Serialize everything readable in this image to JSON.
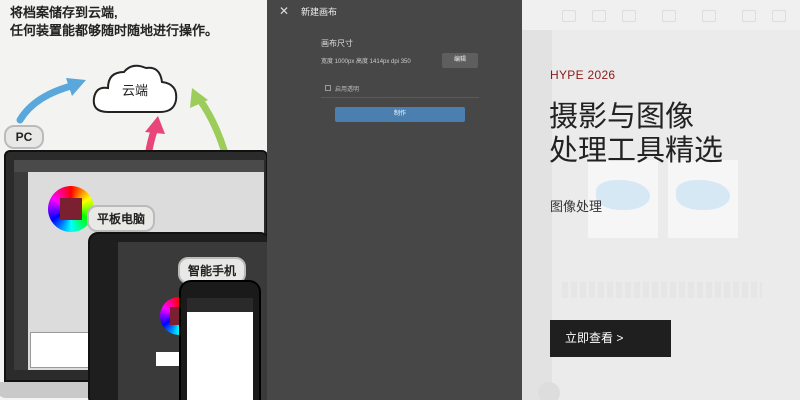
{
  "promo": {
    "headline_line1": "将档案储存到云端,",
    "headline_line2": "任何装置能都够随时随地进行操作。",
    "cloud_label": "云端",
    "devices": {
      "pc": "PC",
      "tablet": "平板电脑",
      "phone": "智能手机"
    },
    "colors": {
      "arrow_blue": "#5aa7dc",
      "arrow_pink": "#e8457a",
      "arrow_green": "#9ccc5a"
    }
  },
  "dialog": {
    "close_icon": "close-icon",
    "title": "新建画布",
    "section_label": "画布尺寸",
    "dimensions": "宽度 1000px  高度 1414px  dpi 350",
    "edit_button": "编辑",
    "checkbox_label": "启用透明",
    "create_button": "制作",
    "colors": {
      "background": "#474747",
      "create_button": "#4a7fb0"
    }
  },
  "card": {
    "year": "HYPE 2026",
    "title_line1": "摄影与图像",
    "title_line2": "处理工具精选",
    "subtitle": "图像处理",
    "cta_label": "立即查看 >",
    "colors": {
      "year": "#8b1a1a",
      "cta_bg": "#1f1f1f"
    }
  }
}
